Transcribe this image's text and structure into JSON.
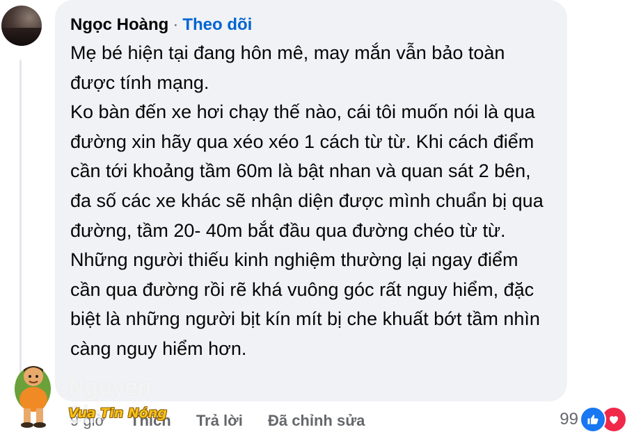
{
  "comment": {
    "author": "Ngọc Hoàng",
    "separator": "·",
    "follow_label": "Theo dõi",
    "paragraphs": [
      "Mẹ bé hiện tại đang hôn mê, may mắn vẫn bảo toàn được tính mạng.",
      "Ko bàn đến xe hơi chạy thế nào, cái tôi muốn nói là qua đường xin hãy qua xéo xéo 1 cách từ từ. Khi cách điểm cần tới khoảng tầm 60m là bật nhan và quan sát 2 bên, đa số các xe khác sẽ nhận diện được mình chuẩn bị qua đường, tầm 20- 40m bắt đầu qua đường chéo từ từ. Những người thiếu kinh nghiệm thường lại ngay điểm cần qua đường rồi rẽ khá vuông góc rất nguy hiểm, đặc biệt là những người bịt kín mít bị che khuất bớt tầm nhìn càng nguy hiểm hơn."
    ],
    "time": "9 giờ",
    "like_label": "Thích",
    "reply_label": "Trả lời",
    "edited_label": "Đã chỉnh sửa",
    "reaction_count": "99",
    "reaction_icons": [
      "like-icon",
      "love-icon"
    ]
  },
  "watermark": {
    "text": "Nguyen Sin",
    "brand": "Vua Tin Nóng"
  },
  "colors": {
    "bubble": "#f0f2f5",
    "link": "#0064d1",
    "muted": "#65676b",
    "like": "#1877f2",
    "love": "#f0284a"
  }
}
